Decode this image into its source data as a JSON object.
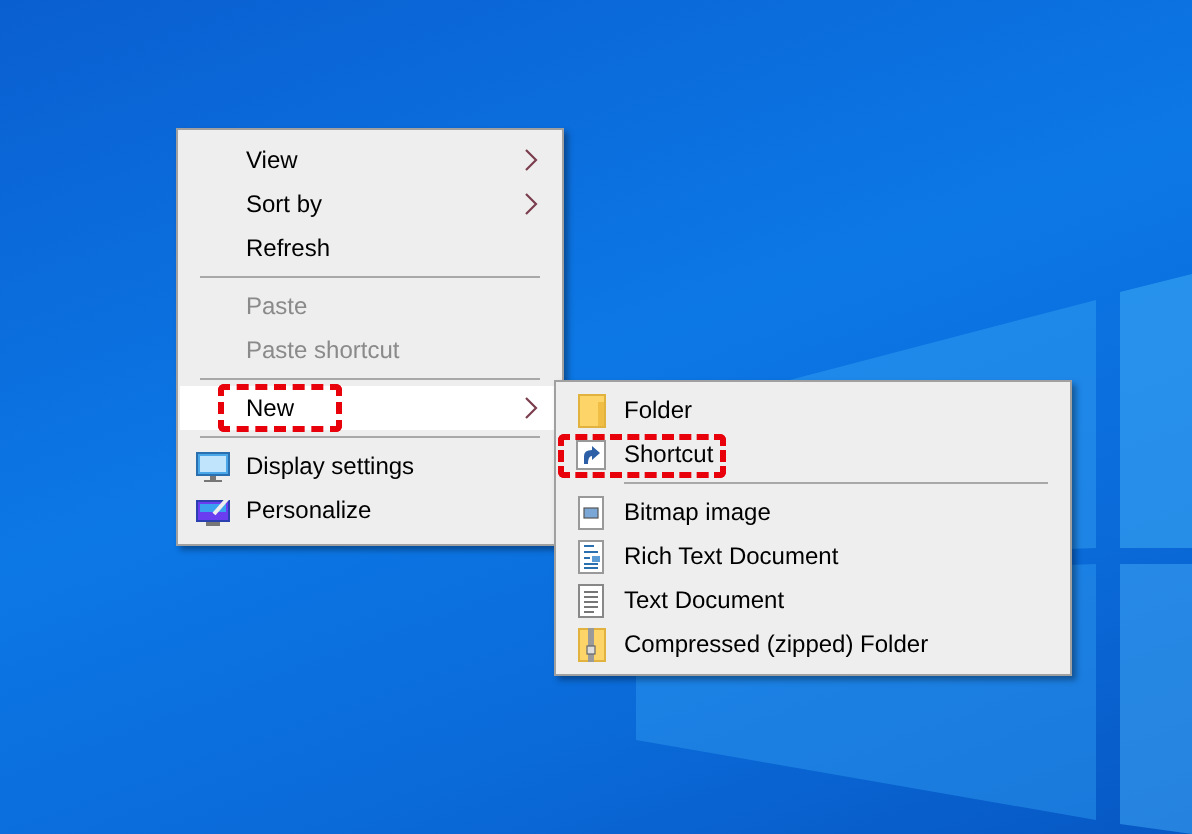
{
  "context_menu": {
    "items": [
      {
        "kind": "item",
        "label": "View",
        "disabled": false,
        "selected": false,
        "submenu": true,
        "annotated": false
      },
      {
        "kind": "item",
        "label": "Sort by",
        "disabled": false,
        "selected": false,
        "submenu": true,
        "annotated": false
      },
      {
        "kind": "item",
        "label": "Refresh",
        "disabled": false,
        "selected": false,
        "submenu": false,
        "annotated": false
      },
      {
        "kind": "separator"
      },
      {
        "kind": "item",
        "label": "Paste",
        "disabled": true,
        "selected": false,
        "submenu": false,
        "annotated": false
      },
      {
        "kind": "item",
        "label": "Paste shortcut",
        "disabled": true,
        "selected": false,
        "submenu": false,
        "annotated": false
      },
      {
        "kind": "separator"
      },
      {
        "kind": "item",
        "label": "New",
        "disabled": false,
        "selected": true,
        "submenu": true,
        "annotated": true
      },
      {
        "kind": "separator"
      },
      {
        "kind": "item",
        "label": "Display settings",
        "disabled": false,
        "selected": false,
        "submenu": false,
        "annotated": false
      },
      {
        "kind": "item",
        "label": "Personalize",
        "disabled": false,
        "selected": false,
        "submenu": false,
        "annotated": false
      }
    ]
  },
  "new_submenu": {
    "items": [
      {
        "kind": "item",
        "label": "Folder",
        "annotated": false
      },
      {
        "kind": "item",
        "label": "Shortcut",
        "annotated": true
      },
      {
        "kind": "separator"
      },
      {
        "kind": "item",
        "label": "Bitmap image",
        "annotated": false
      },
      {
        "kind": "item",
        "label": "Rich Text Document",
        "annotated": false
      },
      {
        "kind": "item",
        "label": "Text Document",
        "annotated": false
      },
      {
        "kind": "item",
        "label": "Compressed (zipped) Folder",
        "annotated": false
      }
    ]
  }
}
